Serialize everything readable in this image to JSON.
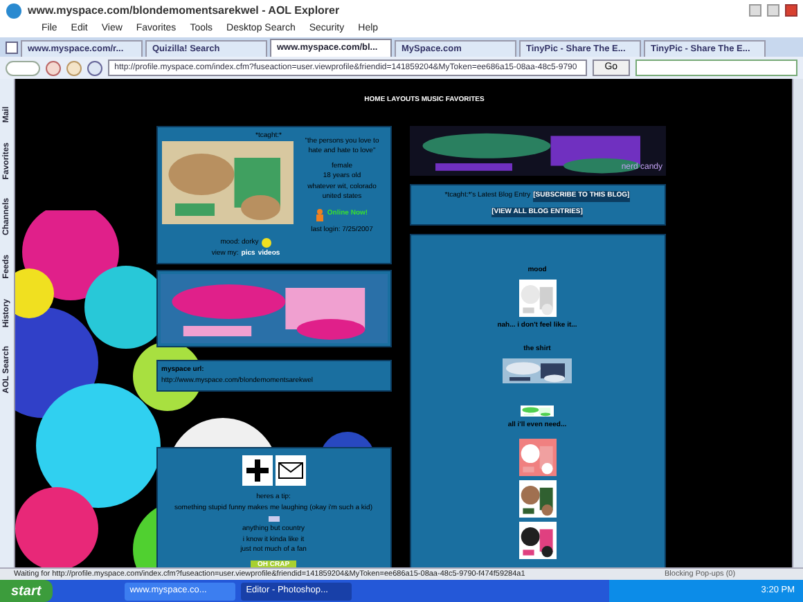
{
  "window": {
    "title": "www.myspace.com/blondemomentsarekwel - AOL Explorer"
  },
  "menu": [
    "File",
    "Edit",
    "View",
    "Favorites",
    "Tools",
    "Desktop Search",
    "Security",
    "Help"
  ],
  "tabs": [
    {
      "label": "www.myspace.com/r...",
      "selected": false
    },
    {
      "label": "Quizilla! Search",
      "selected": false
    },
    {
      "label": "www.myspace.com/bl...",
      "selected": true
    },
    {
      "label": "MySpace.com",
      "selected": false
    },
    {
      "label": "TinyPic - Share The E...",
      "selected": false
    },
    {
      "label": "TinyPic - Share The E...",
      "selected": false
    }
  ],
  "address": {
    "value": "http://profile.myspace.com/index.cfm?fuseaction=user.viewprofile&friendid=141859204&MyToken=ee686a15-08aa-48c5-9790",
    "go": "Go"
  },
  "side_panel": [
    "Mail",
    "Favorites",
    "Channels",
    "Feeds",
    "History",
    "AOL Search"
  ],
  "page": {
    "nav": "HOME LAYOUTS MUSIC FAVORITES",
    "profile": {
      "name": "*tcaght:*",
      "quote": "\"the persons you love to hate and hate to love\"",
      "details": [
        "female",
        "18 years old",
        "whatever wit, colorado",
        "united states"
      ],
      "online": "Online Now!",
      "last_login": "last login: 7/25/2007",
      "mood": "mood: dorky",
      "view": "view my:",
      "links": [
        "pics",
        "videos"
      ]
    },
    "url_box": {
      "label": "myspace url:",
      "url": "http://www.myspace.com/blondemomentsarekwel"
    },
    "contact": {
      "lines": [
        "heres a tip:",
        "something stupid funny makes me laughing (okay i'm such a kid)"
      ],
      "lines2": [
        "anything but country",
        "i know it kinda like it",
        "just not much of a fan"
      ],
      "button": "OH CRAP"
    },
    "blog": {
      "title": "*tcaght:*'s Latest Blog Entry",
      "subscribe": "[SUBSCRIBE TO THIS BLOG]",
      "view_all": "[VIEW ALL BLOG ENTRIES]",
      "banner_caption": "nerd candy"
    },
    "right": {
      "mood": "mood",
      "caption1": "nah... i don't feel like it...",
      "shirt": "the shirt",
      "caption2": "all i'll even need..."
    }
  },
  "status_bar": {
    "text": "Waiting for http://profile.myspace.com/index.cfm?fuseaction=user.viewprofile&friendid=141859204&MyToken=ee686a15-08aa-48c5-9790-f474f59284a1",
    "popups": "Blocking Pop-ups (0)"
  },
  "taskbar": {
    "start": "start",
    "items": [
      {
        "label": "www.myspace.co...",
        "selected": false
      },
      {
        "label": "Editor - Photoshop...",
        "selected": true
      }
    ],
    "clock": "3:20 PM"
  }
}
